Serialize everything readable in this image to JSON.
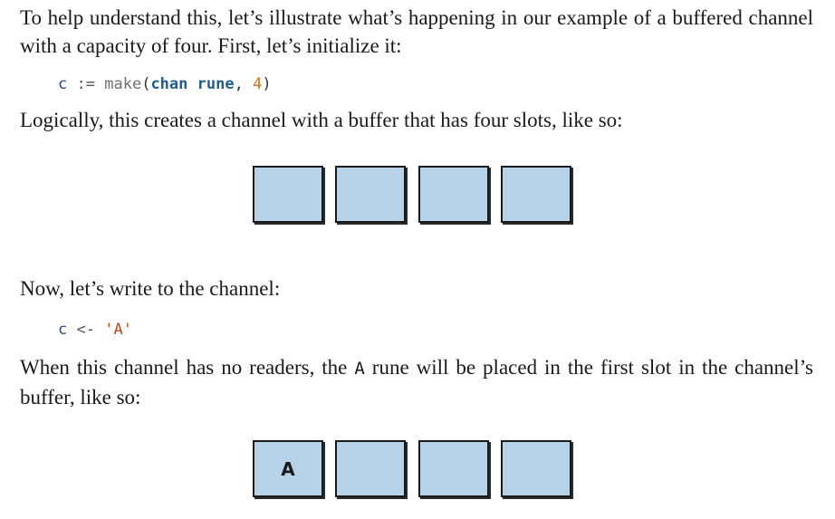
{
  "paragraphs": {
    "p1": "To help understand this, let’s illustrate what’s happening in our example of a buffered channel with a capacity of four. First, let’s initialize it:",
    "p2": "Logically, this creates a channel with a buffer that has four slots, like so:",
    "p3": "Now, let’s write to the channel:",
    "p4_before": "When this channel has no readers, the ",
    "p4_code": "A",
    "p4_after": " rune will be placed in the first slot in the channel’s buffer, like so:"
  },
  "code1": {
    "var": "c",
    "assign": ":=",
    "func": "make",
    "open": "(",
    "kw1": "chan",
    "kw2": "rune",
    "comma": ",",
    "num": "4",
    "close": ")"
  },
  "code2": {
    "var": "c",
    "op": "<-",
    "str": "'A'"
  },
  "diagram1": {
    "slots": [
      "",
      "",
      "",
      ""
    ]
  },
  "diagram2": {
    "slots": [
      "A",
      "",
      "",
      ""
    ]
  },
  "colors": {
    "slot_fill": "#b6d3ea",
    "slot_border": "#1a1a1a",
    "keyword": "#1f5f8b",
    "number": "#d0701a",
    "string": "#c2451b"
  }
}
